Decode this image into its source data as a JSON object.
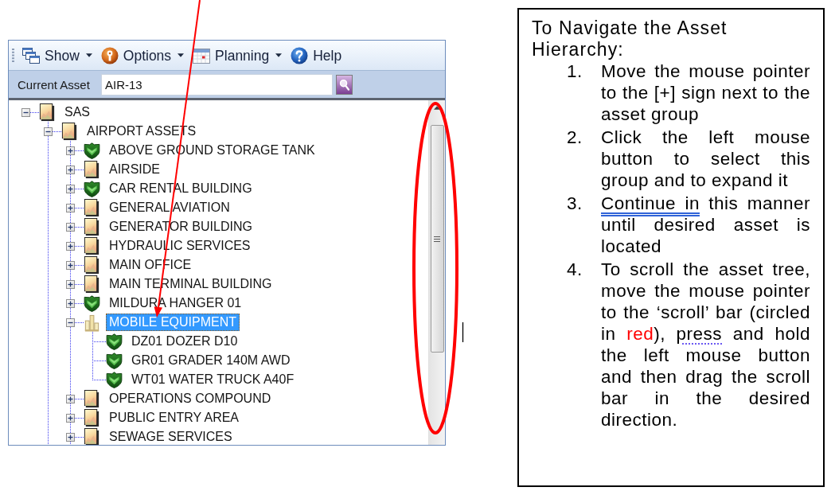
{
  "toolbar": {
    "items": [
      {
        "label": "Show",
        "kind": "dropdown"
      },
      {
        "label": "Options",
        "kind": "dropdown"
      },
      {
        "label": "Planning",
        "kind": "dropdown"
      },
      {
        "label": "Help",
        "kind": "button"
      }
    ]
  },
  "current_asset": {
    "label": "Current Asset",
    "value": "AIR-13"
  },
  "tree": [
    {
      "label": "SAS",
      "kind": "group",
      "expanded": true,
      "selected": false,
      "children": [
        {
          "label": "AIRPORT ASSETS",
          "kind": "group",
          "expanded": true,
          "selected": false,
          "children": [
            {
              "label": "ABOVE GROUND STORAGE TANK",
              "kind": "asset",
              "expanded": false,
              "selected": false
            },
            {
              "label": "AIRSIDE",
              "kind": "group",
              "expanded": false,
              "selected": false
            },
            {
              "label": "CAR RENTAL BUILDING",
              "kind": "asset",
              "expanded": false,
              "selected": false
            },
            {
              "label": "GENERAL AVIATION",
              "kind": "group",
              "expanded": false,
              "selected": false
            },
            {
              "label": "GENERATOR BUILDING",
              "kind": "group",
              "expanded": false,
              "selected": false
            },
            {
              "label": "HYDRAULIC SERVICES",
              "kind": "group",
              "expanded": false,
              "selected": false
            },
            {
              "label": "MAIN OFFICE",
              "kind": "group",
              "expanded": false,
              "selected": false
            },
            {
              "label": "MAIN TERMINAL BUILDING",
              "kind": "group",
              "expanded": false,
              "selected": false
            },
            {
              "label": "MILDURA HANGER 01",
              "kind": "asset",
              "expanded": false,
              "selected": false
            },
            {
              "label": "MOBILE EQUIPMENT",
              "kind": "equipment",
              "expanded": true,
              "selected": true,
              "children": [
                {
                  "label": "DZ01 DOZER D10",
                  "kind": "asset",
                  "selected": false
                },
                {
                  "label": "GR01 GRADER 140M AWD",
                  "kind": "asset",
                  "selected": false
                },
                {
                  "label": "WT01 WATER TRUCK A40F",
                  "kind": "asset",
                  "selected": false
                }
              ]
            },
            {
              "label": "OPERATIONS COMPOUND",
              "kind": "group",
              "expanded": false,
              "selected": false
            },
            {
              "label": "PUBLIC ENTRY AREA",
              "kind": "group",
              "expanded": false,
              "selected": false
            },
            {
              "label": "SEWAGE SERVICES",
              "kind": "group",
              "expanded": false,
              "selected": false
            }
          ]
        }
      ]
    }
  ],
  "instructions": {
    "title": "To Navigate the Asset Hierarchy:",
    "steps": [
      {
        "number": "1.",
        "segments": [
          {
            "kind": "plain",
            "text": "Move the mouse pointer to the [+] sign next to the asset group"
          }
        ]
      },
      {
        "number": "2.",
        "segments": [
          {
            "kind": "plain",
            "text": "Click the left mouse button to select this group and to expand it"
          }
        ]
      },
      {
        "number": "3.",
        "segments": [
          {
            "kind": "grammar",
            "text": "Continue in"
          },
          {
            "kind": "plain",
            "text": " this manner until desired asset is located"
          }
        ]
      },
      {
        "number": "4.",
        "segments": [
          {
            "kind": "plain",
            "text": "To scroll the asset tree, move the mouse pointer to the ‘scroll’ bar (circled in "
          },
          {
            "kind": "colored",
            "text": "red",
            "color": "#ff0000"
          },
          {
            "kind": "plain",
            "text": "), "
          },
          {
            "kind": "spelling",
            "text": "press"
          },
          {
            "kind": "plain",
            "text": " and hold the left mouse button and then drag the scroll bar in the desired direction."
          }
        ]
      }
    ]
  }
}
